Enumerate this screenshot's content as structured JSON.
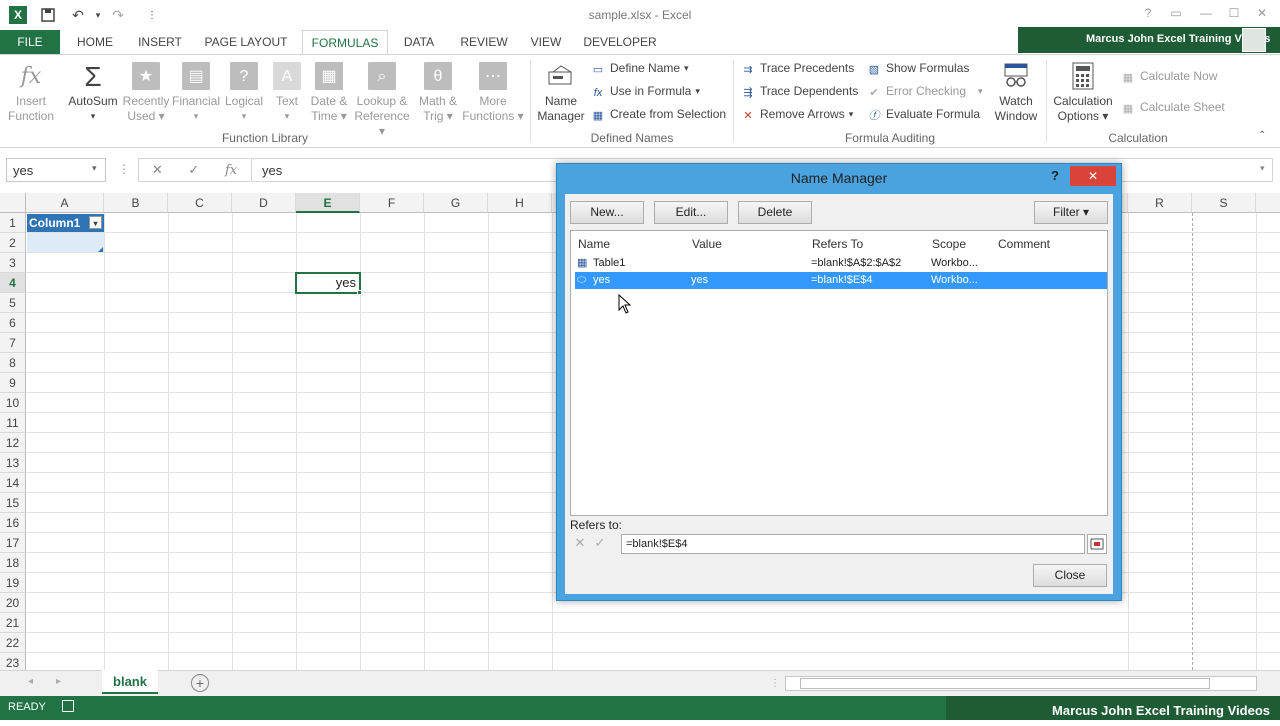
{
  "window": {
    "title": "sample.xlsx - Excel"
  },
  "quick_access": {
    "undo": "↶",
    "redo": "↷"
  },
  "menu": {
    "file": "FILE",
    "tabs": [
      "HOME",
      "INSERT",
      "PAGE LAYOUT",
      "FORMULAS",
      "DATA",
      "REVIEW",
      "VIEW",
      "DEVELOPER"
    ],
    "active": "FORMULAS"
  },
  "brand": "Marcus John Excel Training Videos",
  "ribbon": {
    "function_library": {
      "label": "Function Library",
      "insert_function": [
        "Insert",
        "Function"
      ],
      "autosum": "AutoSum",
      "recently_used": [
        "Recently",
        "Used"
      ],
      "financial": "Financial",
      "logical": "Logical",
      "text": "Text",
      "date_time": [
        "Date &",
        "Time"
      ],
      "lookup": [
        "Lookup &",
        "Reference"
      ],
      "math": [
        "Math &",
        "Trig"
      ],
      "more": [
        "More",
        "Functions"
      ]
    },
    "defined_names": {
      "label": "Defined Names",
      "name_manager": [
        "Name",
        "Manager"
      ],
      "define_name": "Define Name",
      "use_in_formula": "Use in Formula",
      "create_from_selection": "Create from Selection"
    },
    "formula_auditing": {
      "label": "Formula Auditing",
      "trace_precedents": "Trace Precedents",
      "trace_dependents": "Trace Dependents",
      "remove_arrows": "Remove Arrows",
      "show_formulas": "Show Formulas",
      "error_checking": "Error Checking",
      "evaluate_formula": "Evaluate Formula",
      "watch_window": [
        "Watch",
        "Window"
      ]
    },
    "calculation": {
      "label": "Calculation",
      "options": [
        "Calculation",
        "Options"
      ],
      "calculate_now": "Calculate Now",
      "calculate_sheet": "Calculate Sheet"
    }
  },
  "formula_bar": {
    "name_box": "yes",
    "fx": "fx",
    "cancel": "✕",
    "enter": "✓",
    "content": "yes"
  },
  "grid": {
    "columns": [
      "A",
      "B",
      "C",
      "D",
      "E",
      "F",
      "G",
      "H",
      "R",
      "S"
    ],
    "rows": [
      "1",
      "2",
      "3",
      "4",
      "5",
      "6",
      "7",
      "8",
      "9",
      "10",
      "11",
      "12",
      "13",
      "14",
      "15",
      "16",
      "17",
      "18",
      "19",
      "20",
      "21",
      "22",
      "23"
    ],
    "a1_header": "Column1",
    "e4_value": "yes"
  },
  "sheets": {
    "active": "blank",
    "add": "+"
  },
  "status": {
    "mode": "READY"
  },
  "name_manager": {
    "title": "Name Manager",
    "help": "?",
    "close_x": "✕",
    "buttons": {
      "new": "New...",
      "edit": "Edit...",
      "delete": "Delete",
      "filter": "Filter ▾"
    },
    "headers": {
      "name": "Name",
      "value": "Value",
      "refers_to": "Refers To",
      "scope": "Scope",
      "comment": "Comment"
    },
    "rows": [
      {
        "name": "Table1",
        "value": "",
        "refers_to": "=blank!$A$2:$A$2",
        "scope": "Workbo...",
        "comment": ""
      },
      {
        "name": "yes",
        "value": "yes",
        "refers_to": "=blank!$E$4",
        "scope": "Workbo...",
        "comment": ""
      }
    ],
    "refers_to_label": "Refers to:",
    "refers_to_value": "=blank!$E$4",
    "close_button": "Close"
  }
}
